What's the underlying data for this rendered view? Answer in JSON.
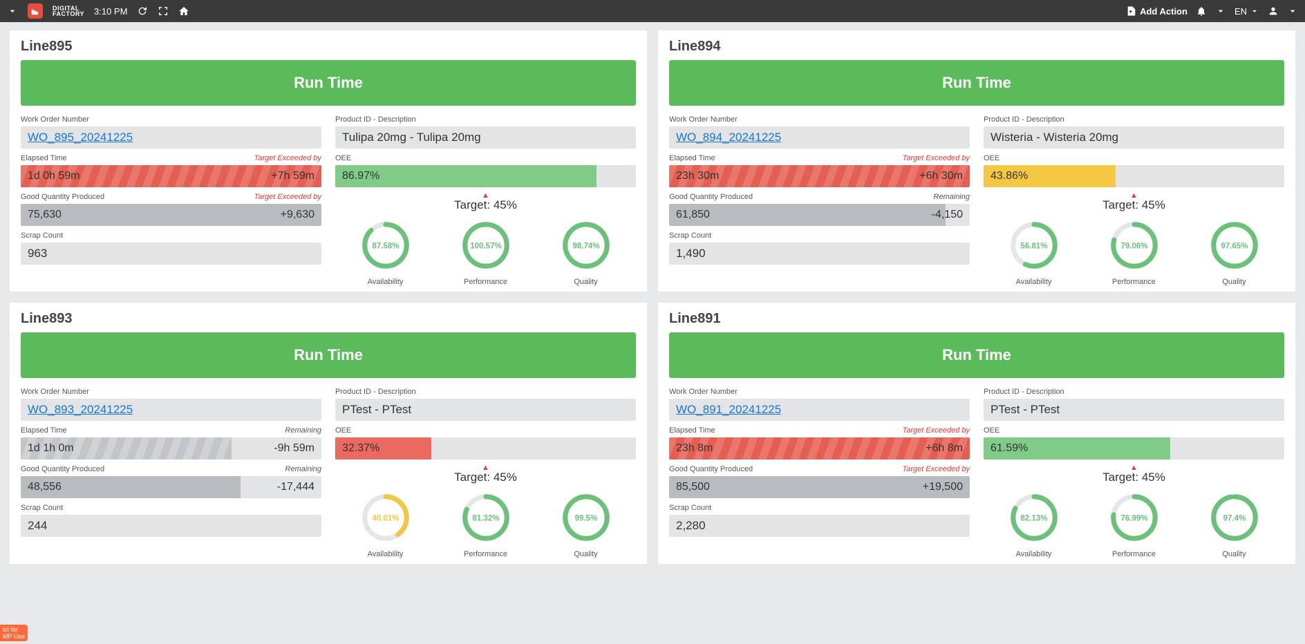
{
  "header": {
    "brand_line1": "DIGITAL",
    "brand_line2": "FACTORY",
    "time": "3:10 PM",
    "add_action": "Add Action",
    "lang": "EN"
  },
  "labels": {
    "work_order": "Work Order Number",
    "product": "Product ID - Description",
    "elapsed": "Elapsed Time",
    "oee": "OEE",
    "good_qty": "Good Quantity Produced",
    "scrap": "Scrap Count",
    "target_exceeded": "Target Exceeded by",
    "remaining": "Remaining",
    "target": "Target: 45%",
    "availability": "Availability",
    "performance": "Performance",
    "quality": "Quality",
    "runtime": "Run Time"
  },
  "notice": {
    "line1": "ict for",
    "line2": "MP Use"
  },
  "cards": [
    {
      "line": "Line895",
      "wo": "WO_895_20241225",
      "product": "Tulipa 20mg - Tulipa 20mg",
      "elapsed": "1d 0h 59m",
      "elapsed_delta": "+7h 59m",
      "elapsed_status": "exceeded",
      "elapsed_fill_pct": 100,
      "good_qty": "75,630",
      "good_delta": "+9,630",
      "good_status": "exceeded",
      "good_fill_pct": 100,
      "scrap": "963",
      "oee": "86.97%",
      "oee_pct": 87,
      "oee_color": "green",
      "gauges": [
        {
          "label": "availability",
          "value": "87.58%",
          "pct": 87.58,
          "color": "green"
        },
        {
          "label": "performance",
          "value": "100.57%",
          "pct": 100,
          "color": "green"
        },
        {
          "label": "quality",
          "value": "98.74%",
          "pct": 98.74,
          "color": "green"
        }
      ]
    },
    {
      "line": "Line894",
      "wo": "WO_894_20241225",
      "product": "Wisteria - Wisteria 20mg",
      "elapsed": "23h 30m",
      "elapsed_delta": "+6h 30m",
      "elapsed_status": "exceeded",
      "elapsed_fill_pct": 100,
      "good_qty": "61,850",
      "good_delta": "-4,150",
      "good_status": "remaining",
      "good_fill_pct": 92,
      "scrap": "1,490",
      "oee": "43.86%",
      "oee_pct": 44,
      "oee_color": "yellow",
      "gauges": [
        {
          "label": "availability",
          "value": "56.81%",
          "pct": 56.81,
          "color": "green"
        },
        {
          "label": "performance",
          "value": "79.06%",
          "pct": 79.06,
          "color": "green"
        },
        {
          "label": "quality",
          "value": "97.65%",
          "pct": 97.65,
          "color": "green"
        }
      ]
    },
    {
      "line": "Line893",
      "wo": "WO_893_20241225",
      "product": "PTest - PTest",
      "elapsed": "1d 1h 0m",
      "elapsed_delta": "-9h 59m",
      "elapsed_status": "remaining",
      "elapsed_fill_pct": 70,
      "good_qty": "48,556",
      "good_delta": "-17,444",
      "good_status": "remaining",
      "good_fill_pct": 73,
      "scrap": "244",
      "oee": "32.37%",
      "oee_pct": 32,
      "oee_color": "red",
      "gauges": [
        {
          "label": "availability",
          "value": "40.01%",
          "pct": 40.01,
          "color": "yellow"
        },
        {
          "label": "performance",
          "value": "81.32%",
          "pct": 81.32,
          "color": "green"
        },
        {
          "label": "quality",
          "value": "99.5%",
          "pct": 99.5,
          "color": "green"
        }
      ]
    },
    {
      "line": "Line891",
      "wo": "WO_891_20241225",
      "product": "PTest - PTest",
      "elapsed": "23h 8m",
      "elapsed_delta": "+6h 8m",
      "elapsed_status": "exceeded",
      "elapsed_fill_pct": 100,
      "good_qty": "85,500",
      "good_delta": "+19,500",
      "good_status": "exceeded",
      "good_fill_pct": 100,
      "scrap": "2,280",
      "oee": "61.59%",
      "oee_pct": 62,
      "oee_color": "green",
      "gauges": [
        {
          "label": "availability",
          "value": "82.13%",
          "pct": 82.13,
          "color": "green"
        },
        {
          "label": "performance",
          "value": "76.99%",
          "pct": 76.99,
          "color": "green"
        },
        {
          "label": "quality",
          "value": "97.4%",
          "pct": 97.4,
          "color": "green"
        }
      ]
    }
  ]
}
